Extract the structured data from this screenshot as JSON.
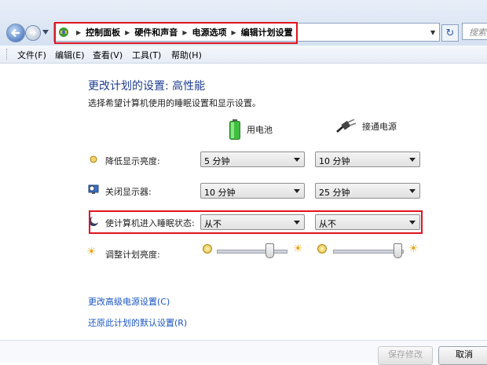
{
  "address": {
    "breadcrumbs": [
      "控制面板",
      "硬件和声音",
      "电源选项",
      "编辑计划设置"
    ],
    "search_placeholder": "搜索"
  },
  "menu": [
    "文件(F)",
    "编辑(E)",
    "查看(V)",
    "工具(T)",
    "帮助(H)"
  ],
  "page": {
    "title": "更改计划的设置: 高性能",
    "subtitle": "选择希望计算机使用的睡眠设置和显示设置。"
  },
  "columns": {
    "battery": "用电池",
    "plugged": "接通电源"
  },
  "rows": [
    {
      "label": "降低显示亮度:",
      "battery": "5 分钟",
      "plugged": "10 分钟"
    },
    {
      "label": "关闭显示器:",
      "battery": "10 分钟",
      "plugged": "25 分钟"
    },
    {
      "label": "使计算机进入睡眠状态:",
      "battery": "从不",
      "plugged": "从不"
    }
  ],
  "brightness": {
    "label": "调整计划亮度:",
    "battery_level": 0.8,
    "plugged_level": 1.0
  },
  "links": {
    "advanced": "更改高级电源设置(C)",
    "restore": "还原此计划的默认设置(R)"
  },
  "buttons": {
    "save": "保存修改",
    "cancel": "取消"
  },
  "colors": {
    "highlight_box": "#e0141e",
    "title": "#1e3d8f",
    "link": "#1a56c2"
  }
}
